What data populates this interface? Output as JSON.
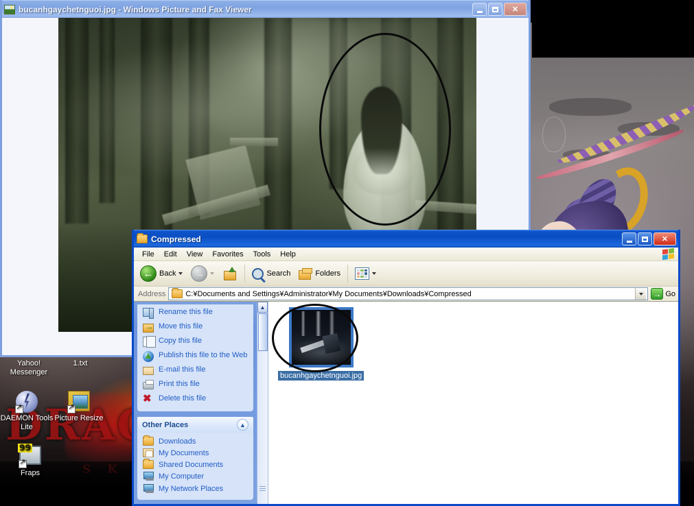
{
  "desktop": {
    "icons": [
      {
        "label": "Yahoo!\nMessenger",
        "name": "yahoo-messenger",
        "label_line1": "Yahoo!",
        "label_line2": "Messenger"
      },
      {
        "label": "1.txt",
        "name": "1-txt"
      },
      {
        "label": "DAEMON Tools Lite",
        "name": "daemon-tools-lite"
      },
      {
        "label": "Picture Resize",
        "name": "picture-resize"
      },
      {
        "label": "Fraps",
        "name": "fraps",
        "badge": "99"
      }
    ],
    "wallpaper": {
      "title": "DRAG",
      "subtitle": "S K Y"
    }
  },
  "viewer": {
    "title": "bucanhgaychetnguoi.jpg - Windows Picture and Fax Viewer",
    "buttons": {
      "minimize": "_",
      "maximize": "□",
      "close": "✕"
    }
  },
  "explorer": {
    "title": "Compressed",
    "buttons": {
      "minimize": "_",
      "maximize": "□",
      "close": "✕"
    },
    "menu": [
      "File",
      "Edit",
      "View",
      "Favorites",
      "Tools",
      "Help"
    ],
    "toolbar": {
      "back": "Back",
      "forward": "",
      "up": "",
      "search": "Search",
      "folders": "Folders",
      "views": ""
    },
    "address": {
      "label": "Address",
      "value": "C:¥Documents and Settings¥Administrator¥My Documents¥Downloads¥Compressed",
      "go": "Go"
    },
    "file_tasks": {
      "items": [
        {
          "label": "Rename this file",
          "icon": "rename-icon"
        },
        {
          "label": "Move this file",
          "icon": "move-icon"
        },
        {
          "label": "Copy this file",
          "icon": "copy-icon"
        },
        {
          "label": "Publish this file to the Web",
          "icon": "publish-icon"
        },
        {
          "label": "E-mail this file",
          "icon": "email-icon"
        },
        {
          "label": "Print this file",
          "icon": "print-icon"
        },
        {
          "label": "Delete this file",
          "icon": "delete-icon"
        }
      ]
    },
    "other_places": {
      "header": "Other Places",
      "items": [
        {
          "label": "Downloads",
          "icon": "folder-icon"
        },
        {
          "label": "My Documents",
          "icon": "my-documents-icon"
        },
        {
          "label": "Shared Documents",
          "icon": "folder-icon"
        },
        {
          "label": "My Computer",
          "icon": "my-computer-icon"
        },
        {
          "label": "My Network Places",
          "icon": "network-icon"
        }
      ]
    },
    "files": [
      {
        "name": "bucanhgaychetnguoi.jpg",
        "selected": true
      }
    ]
  },
  "colors": {
    "title_active": "#0a4ec4",
    "title_inactive": "#8fb0e8",
    "close_button": "#cf2a17",
    "selection": "#3a6ea5",
    "link": "#215dc6",
    "panel_bg": "#d6e3f8"
  }
}
